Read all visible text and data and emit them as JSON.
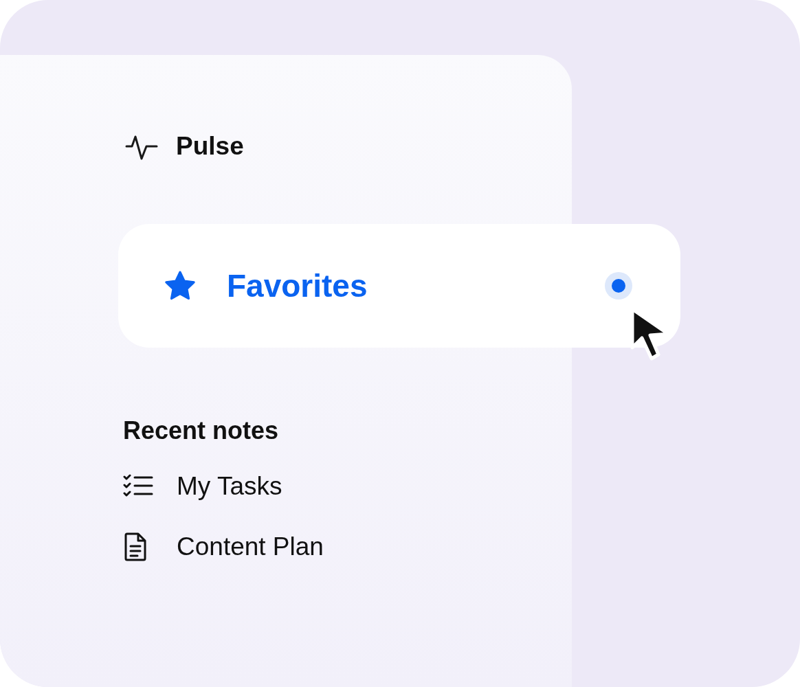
{
  "brand": {
    "name": "Pulse"
  },
  "pinned": [
    {
      "label": "Favorites",
      "selected": true
    }
  ],
  "recent": {
    "title": "Recent notes",
    "items": [
      {
        "label": "My Tasks",
        "kind": "checklist"
      },
      {
        "label": "Content Plan",
        "kind": "document"
      }
    ]
  }
}
